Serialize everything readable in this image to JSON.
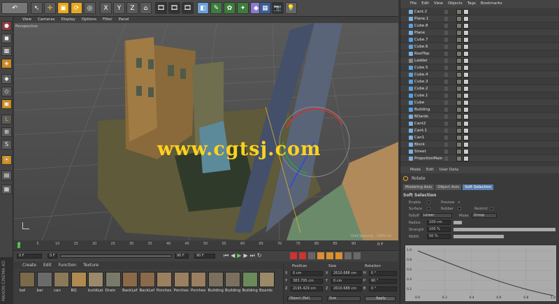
{
  "toolbar": {
    "undo_icon": "undo-icon",
    "axes": [
      "X",
      "Y",
      "Z"
    ]
  },
  "viewport": {
    "menu": [
      "View",
      "Cameras",
      "Display",
      "Options",
      "Filter",
      "Panel"
    ],
    "label": "Perspective",
    "grid_spacing": "Grid Spacing : 1000 cm",
    "watermark": "www.cgtsj.com"
  },
  "timeline": {
    "ticks": [
      "0",
      "5",
      "10",
      "15",
      "20",
      "25",
      "30",
      "35",
      "40",
      "45",
      "50",
      "55",
      "60",
      "65",
      "70",
      "75",
      "80",
      "85",
      "90"
    ],
    "end": "0 F"
  },
  "transport": {
    "start": "0 F",
    "current": "0 F",
    "end": "90 F",
    "max": "90 F"
  },
  "materials": {
    "menu": [
      "Create",
      "Edit",
      "Function",
      "Texture"
    ],
    "items": [
      "bel",
      "bar",
      "can",
      "BQ",
      "buildLei",
      "Drain",
      "BackLef",
      "BackLef",
      "Porches",
      "Porches",
      "Porches",
      "Building",
      "Building",
      "Building",
      "Boards"
    ]
  },
  "coords": {
    "headers": [
      "Position",
      "Size",
      "Rotation"
    ],
    "rows": [
      {
        "axis": "X",
        "pos": "0 cm",
        "sx": "X",
        "size": "2610.688 cm",
        "rl": "H",
        "rot": "0 °"
      },
      {
        "axis": "Y",
        "pos": "383.795 cm",
        "sx": "Y",
        "size": "0 cm",
        "rl": "P",
        "rot": "90 °"
      },
      {
        "axis": "Z",
        "pos": "2195.429 cm",
        "sx": "Z",
        "size": "2610.688 cm",
        "rl": "B",
        "rot": "0 °"
      }
    ],
    "mode": "Object (Rel)",
    "size_mode": "Size",
    "apply": "Apply"
  },
  "objects": {
    "menu": [
      "File",
      "Edit",
      "View",
      "Objects",
      "Tags",
      "Bookmarks"
    ],
    "items": [
      "Cant.2",
      "Plane.1",
      "Cube.8",
      "Plane",
      "Cube.7",
      "Cube.6",
      "RoofTop",
      "Ladder",
      "Cube.5",
      "Cube.4",
      "Cube.3",
      "Cube.2",
      "Cube.1",
      "Cube",
      "Building",
      "BOards",
      "Cant2",
      "Cant.1",
      "Can1",
      "Block",
      "Street",
      "ProjectionMain"
    ]
  },
  "attributes": {
    "menu": [
      "Mode",
      "Edit",
      "User Data"
    ],
    "object": "Rotate",
    "tabs": [
      "Modeling Axis",
      "Object Axis",
      "Soft Selection"
    ],
    "section": "Soft Selection",
    "enable": "Enable",
    "preview": "Preview",
    "surface": "Surface",
    "rubber": "Rubber",
    "restrict": "Restrict",
    "falloff_label": "Falloff",
    "falloff_val": "Linear",
    "mode_label": "Mode",
    "mode_val": "Group",
    "radius_label": "Radius",
    "radius_val": "100 cm",
    "strength_label": "Strength",
    "strength_val": "100 %",
    "width_label": "Width",
    "width_val": "50 %",
    "graph_y": [
      "1.0",
      "0.8",
      "0.6",
      "0.4",
      "0.2"
    ],
    "graph_x": [
      "0.0",
      "0.2",
      "0.4",
      "0.6",
      "0.8",
      "1.0"
    ]
  }
}
